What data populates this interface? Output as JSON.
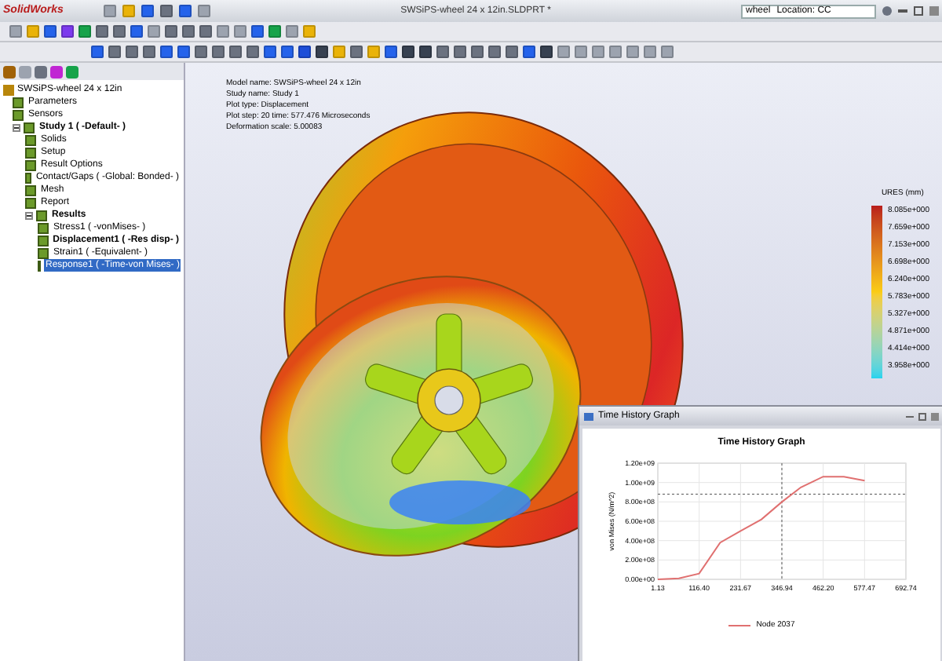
{
  "app": {
    "logo": "SolidWorks",
    "title": "SWSiPS-wheel 24 x 12in.SLDPRT *",
    "search": {
      "value": "wheel",
      "scope": "Location: CC"
    }
  },
  "tree": {
    "root": "SWSiPS-wheel 24 x 12in",
    "items": [
      {
        "label": "Parameters",
        "bold": false,
        "selected": false
      },
      {
        "label": "Sensors",
        "bold": false,
        "selected": false
      },
      {
        "label": "Study 1 ( -Default- )",
        "bold": true,
        "selected": false,
        "expanded": true,
        "children": [
          {
            "label": "Solids",
            "bold": false,
            "selected": false
          },
          {
            "label": "Setup",
            "bold": false,
            "selected": false
          },
          {
            "label": "Result Options",
            "bold": false,
            "selected": false
          },
          {
            "label": "Contact/Gaps ( -Global: Bonded- )",
            "bold": false,
            "selected": false
          },
          {
            "label": "Mesh",
            "bold": false,
            "selected": false
          },
          {
            "label": "Report",
            "bold": false,
            "selected": false
          },
          {
            "label": "Results",
            "bold": true,
            "selected": false,
            "expanded": true,
            "children": [
              {
                "label": "Stress1 ( -vonMises- )",
                "bold": false,
                "selected": false
              },
              {
                "label": "Displacement1 ( -Res disp- )",
                "bold": true,
                "selected": false
              },
              {
                "label": "Strain1 ( -Equivalent- )",
                "bold": false,
                "selected": false
              },
              {
                "label": "Response1 ( -Time-von Mises- )",
                "bold": false,
                "selected": true
              }
            ]
          }
        ]
      }
    ]
  },
  "model_info": [
    "Model name: SWSiPS-wheel 24 x 12in",
    "Study name: Study 1",
    "Plot type: Displacement",
    "Plot step: 20   time: 577.476 Microseconds",
    "Deformation scale: 5.00083"
  ],
  "legend": {
    "title": "URES (mm)",
    "values": [
      "8.085e+000",
      "7.659e+000",
      "7.153e+000",
      "6.698e+000",
      "6.240e+000",
      "5.783e+000",
      "5.327e+000",
      "4.871e+000",
      "4.414e+000",
      "3.958e+000"
    ]
  },
  "graph_window": {
    "title": "Time History Graph",
    "chart_data": {
      "type": "line",
      "title": "Time History Graph",
      "ylabel": "von Mises (N/m^2)",
      "x": [
        1.13,
        60,
        116.4,
        175,
        231.67,
        290,
        346.94,
        400,
        462.2,
        520,
        577.47
      ],
      "series": [
        {
          "name": "Node 2037",
          "color": "#e07070",
          "values": [
            0,
            10000000,
            60000000,
            380000000,
            500000000,
            620000000,
            800000000,
            950000000,
            1060000000,
            1060000000,
            1020000000
          ]
        }
      ],
      "xlim": [
        1.13,
        692.74
      ],
      "ylim": [
        0,
        1200000000
      ],
      "xticks": [
        {
          "value": 1.13,
          "label": "1.13"
        },
        {
          "value": 116.4,
          "label": "116.40"
        },
        {
          "value": 231.67,
          "label": "231.67"
        },
        {
          "value": 346.94,
          "label": "346.94"
        },
        {
          "value": 462.2,
          "label": "462.20"
        },
        {
          "value": 577.47,
          "label": "577.47"
        },
        {
          "value": 692.74,
          "label": "692.74"
        }
      ],
      "grid": true,
      "ref_lines": [
        {
          "axis": "x",
          "value": 346.94
        },
        {
          "axis": "y",
          "value": 880000000
        }
      ],
      "yticks": [
        {
          "value": 0,
          "label": "0.00e+00"
        },
        {
          "value": 200000000,
          "label": "2.00e+08"
        },
        {
          "value": 400000000,
          "label": "4.00e+08"
        },
        {
          "value": 600000000,
          "label": "6.00e+08"
        },
        {
          "value": 800000000,
          "label": "8.00e+08"
        },
        {
          "value": 1000000000,
          "label": "1.00e+09"
        },
        {
          "value": 1200000000,
          "label": "1.20e+09"
        }
      ]
    }
  }
}
